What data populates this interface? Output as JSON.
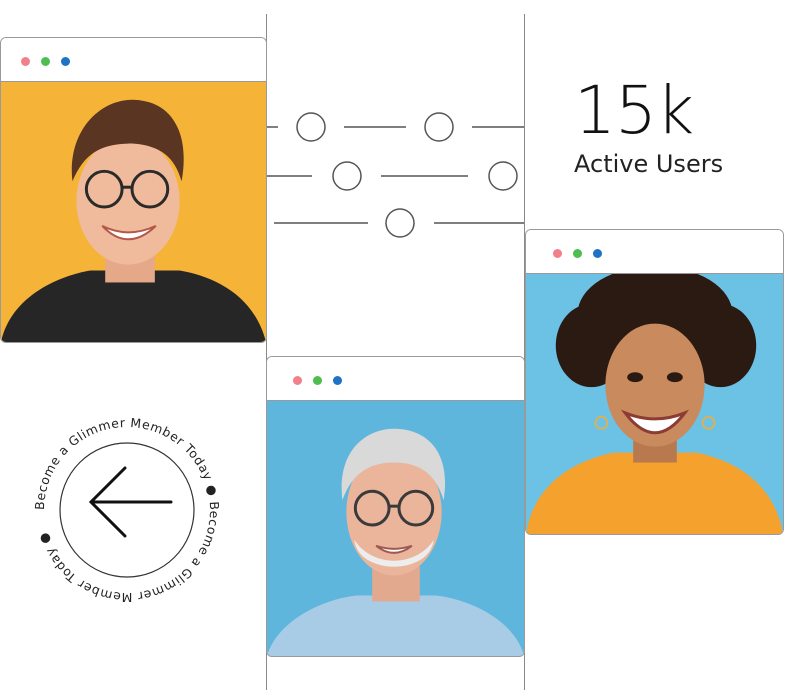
{
  "stat": {
    "number": "15k",
    "label": "Active Users"
  },
  "badge": {
    "ring_text": "Become a Glimmer Member Today ● Become a Glimmer Member Today ●",
    "icon": "arrow-left-icon"
  },
  "cards": [
    {
      "name": "young-man-portrait",
      "background": "#f4b030"
    },
    {
      "name": "older-man-portrait",
      "background": "#5fb6dc"
    },
    {
      "name": "woman-portrait",
      "background": "#6cc2e4"
    }
  ],
  "window_dots": {
    "red": "#f2808a",
    "green": "#4fbd4f",
    "blue": "#1f73c4"
  }
}
